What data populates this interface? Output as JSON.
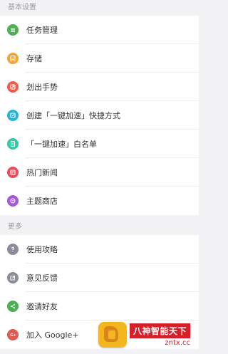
{
  "sections": [
    {
      "header": "基本设置",
      "items": [
        {
          "label": "任务管理",
          "icon": "task-list-icon",
          "color": "#4caf50"
        },
        {
          "label": "存储",
          "icon": "storage-icon",
          "color": "#f2a33a"
        },
        {
          "label": "划出手势",
          "icon": "gesture-icon",
          "color": "#f05a4a"
        },
        {
          "label": "创建「一键加速」快捷方式",
          "icon": "shortcut-icon",
          "color": "#27b3d8"
        },
        {
          "label": "「一键加速」白名单",
          "icon": "whitelist-icon",
          "color": "#33c9a5"
        },
        {
          "label": "热门新闻",
          "icon": "news-icon",
          "color": "#e84b5c"
        },
        {
          "label": "主题商店",
          "icon": "theme-store-icon",
          "color": "#a25ad6"
        }
      ]
    },
    {
      "header": "更多",
      "items": [
        {
          "label": "使用攻略",
          "icon": "help-icon",
          "color": "#8a8d99"
        },
        {
          "label": "意见反馈",
          "icon": "feedback-icon",
          "color": "#8a8d99"
        },
        {
          "label": "邀请好友",
          "icon": "share-icon",
          "color": "#4caf50"
        },
        {
          "label": "加入 Google+",
          "icon": "google-plus-icon",
          "color": "#e05a4e"
        }
      ]
    }
  ],
  "watermark": {
    "title": "八神智能天下",
    "url": "zntx.cc"
  }
}
